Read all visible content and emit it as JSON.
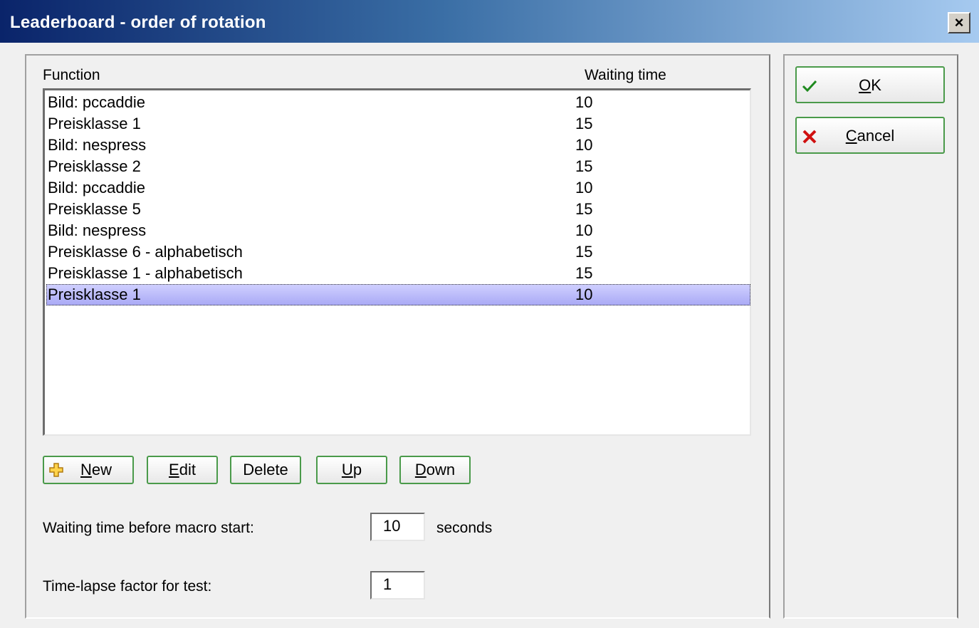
{
  "window": {
    "title": "Leaderboard - order of rotation",
    "close_label": "×"
  },
  "list": {
    "headers": {
      "function": "Function",
      "waiting_time": "Waiting time"
    },
    "rows": [
      {
        "function": "Bild: pccaddie",
        "waiting_time": "10"
      },
      {
        "function": "Preisklasse 1",
        "waiting_time": "15"
      },
      {
        "function": "Bild: nespress",
        "waiting_time": "10"
      },
      {
        "function": "Preisklasse 2",
        "waiting_time": "15"
      },
      {
        "function": "Bild: pccaddie",
        "waiting_time": "10"
      },
      {
        "function": "Preisklasse 5",
        "waiting_time": "15"
      },
      {
        "function": "Bild: nespress",
        "waiting_time": "10"
      },
      {
        "function": "Preisklasse 6 - alphabetisch",
        "waiting_time": "15"
      },
      {
        "function": "Preisklasse 1 - alphabetisch",
        "waiting_time": "15"
      },
      {
        "function": "Preisklasse 1",
        "waiting_time": "10"
      }
    ],
    "selected_index": 9
  },
  "buttons": {
    "new": {
      "mnemonic": "N",
      "rest": "ew"
    },
    "edit": {
      "mnemonic": "E",
      "rest": "dit"
    },
    "delete": {
      "label": "Delete"
    },
    "up": {
      "mnemonic": "U",
      "rest": "p"
    },
    "down": {
      "mnemonic": "D",
      "rest": "own"
    },
    "ok": {
      "mnemonic": "O",
      "rest": "K"
    },
    "cancel": {
      "mnemonic": "C",
      "rest": "ancel"
    }
  },
  "settings": {
    "macro_wait_label": "Waiting time before macro start:",
    "macro_wait_value": "10",
    "macro_wait_unit": "seconds",
    "timelapse_label": "Time-lapse factor for test:",
    "timelapse_value": "1"
  },
  "colors": {
    "accent_border": "#4a9a4a",
    "selection": "#a9a9f5",
    "title_start": "#0a246a"
  }
}
